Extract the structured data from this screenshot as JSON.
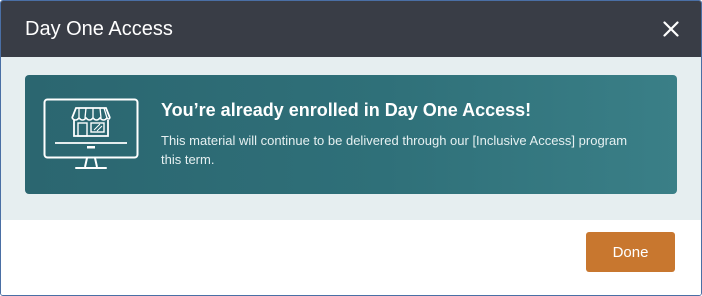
{
  "dialog": {
    "title": "Day One Access",
    "close_icon": "close-icon"
  },
  "banner": {
    "icon": "storefront-monitor-icon",
    "heading": "You’re already enrolled in Day One Access!",
    "message": "This material will continue to be delivered through our [Inclusive Access] program this term."
  },
  "footer": {
    "done_label": "Done"
  },
  "colors": {
    "header_bg": "#393d46",
    "banner_bg": "#2f7079",
    "body_bg": "#e6eef0",
    "done_button": "#c8772f"
  }
}
